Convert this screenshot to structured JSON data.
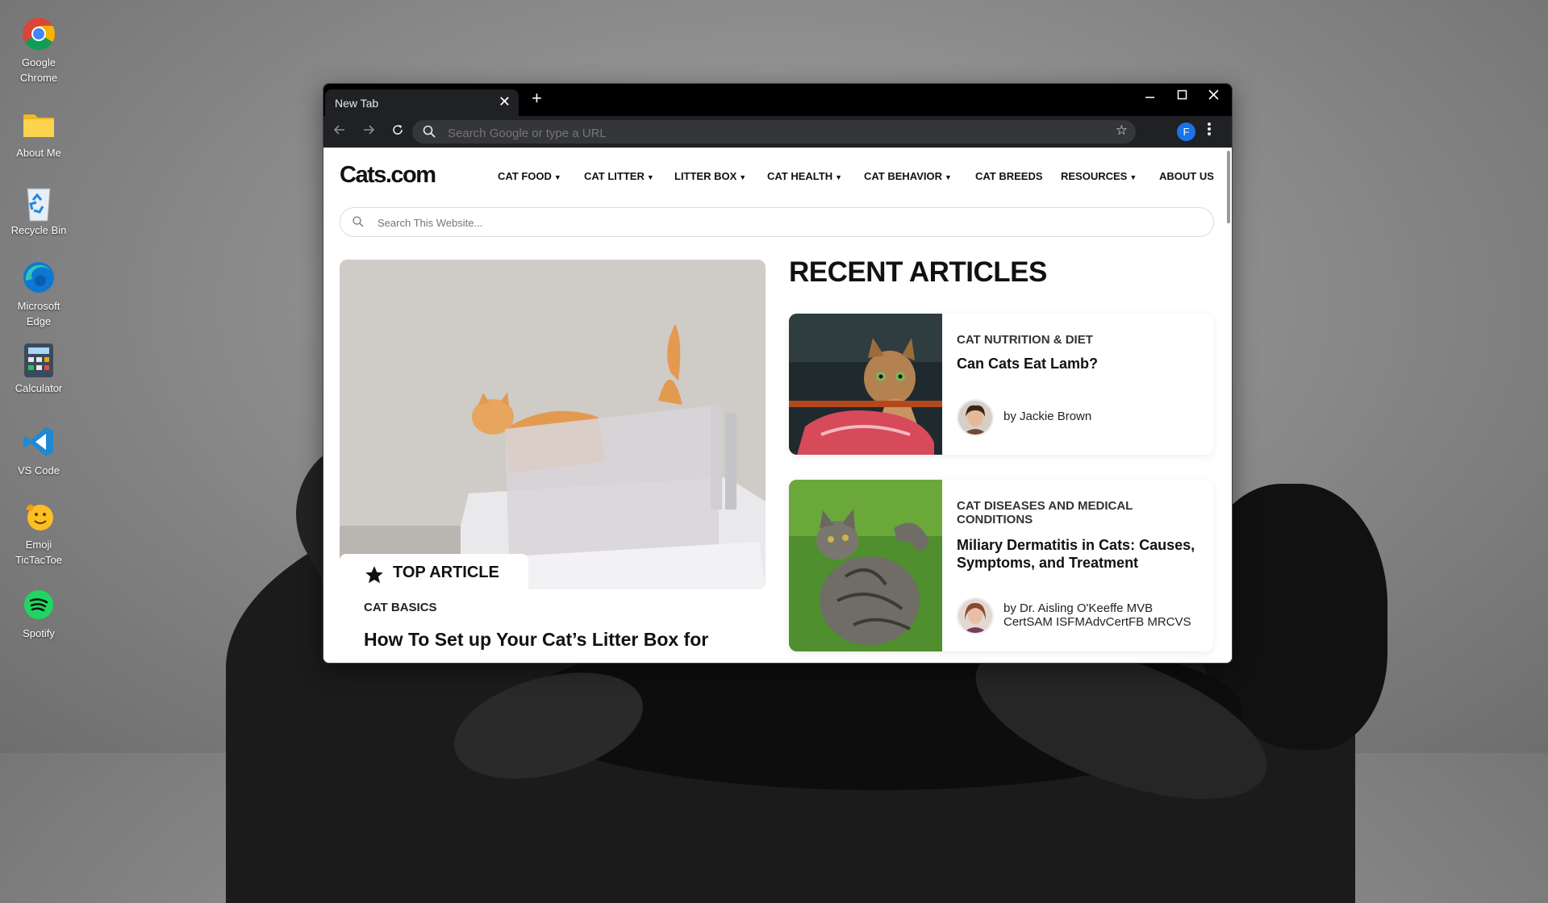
{
  "desktop": {
    "icons": [
      {
        "label": "Google Chrome",
        "icon": "chrome-icon"
      },
      {
        "label": "About Me",
        "icon": "folder-icon"
      },
      {
        "label": "Recycle Bin",
        "icon": "recycle-bin-icon"
      },
      {
        "label": "Microsoft Edge",
        "icon": "edge-icon"
      },
      {
        "label": "Calculator",
        "icon": "calculator-icon"
      },
      {
        "label": "VS Code",
        "icon": "vscode-icon"
      },
      {
        "label": "Emoji TicTacToe",
        "icon": "emoji-icon"
      },
      {
        "label": "Spotify",
        "icon": "spotify-icon"
      }
    ]
  },
  "browser": {
    "tab_title": "New Tab",
    "tab_close": "✕",
    "new_tab": "+",
    "omnibox_placeholder": "Search Google or type a URL",
    "profile_initial": "F",
    "colors": {
      "accent": "#1a73e8",
      "frame": "#000000",
      "toolbar": "#202124"
    }
  },
  "site": {
    "logo": "Cats.com",
    "nav": [
      {
        "label": "CAT FOOD",
        "dropdown": true
      },
      {
        "label": "CAT LITTER",
        "dropdown": true
      },
      {
        "label": "LITTER BOX",
        "dropdown": true
      },
      {
        "label": "CAT HEALTH",
        "dropdown": true
      },
      {
        "label": "CAT BEHAVIOR",
        "dropdown": true
      },
      {
        "label": "CAT BREEDS",
        "dropdown": false
      },
      {
        "label": "RESOURCES",
        "dropdown": true
      },
      {
        "label": "ABOUT US",
        "dropdown": false
      }
    ],
    "search_placeholder": "Search This Website...",
    "top_article": {
      "badge": "TOP ARTICLE",
      "category": "CAT BASICS",
      "title": "How To Set up Your Cat’s Litter Box for"
    },
    "recent_heading": "RECENT ARTICLES",
    "recent": [
      {
        "category": "CAT NUTRITION & DIET",
        "title": "Can Cats Eat Lamb?",
        "author": "by Jackie Brown"
      },
      {
        "category": "CAT DISEASES AND MEDICAL CONDITIONS",
        "title": "Miliary Dermatitis in Cats: Causes, Symptoms, and Treatment",
        "author": "by Dr. Aisling O'Keeffe MVB CertSAM ISFMAdvCertFB MRCVS"
      }
    ]
  }
}
